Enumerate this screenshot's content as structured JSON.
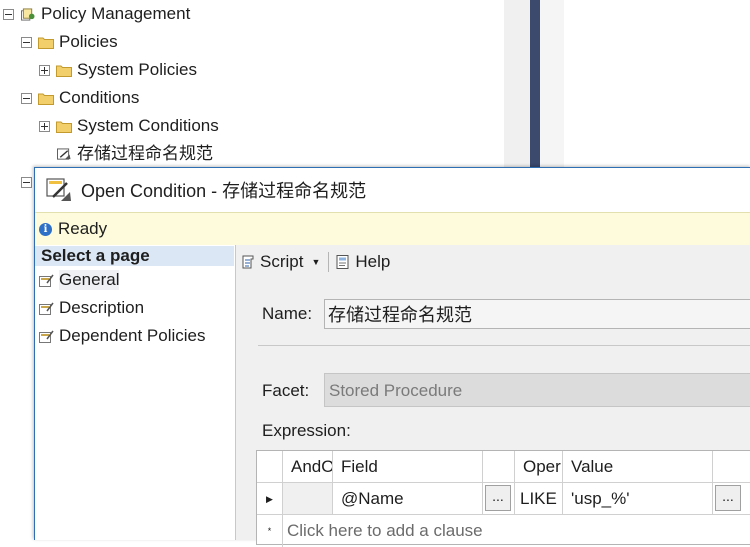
{
  "tree": {
    "items": [
      {
        "label": "Policy Management",
        "expander": "minus",
        "icon": "policy-management-icon"
      },
      {
        "label": "Policies",
        "expander": "minus",
        "icon": "folder-icon"
      },
      {
        "label": "System Policies",
        "expander": "plus",
        "icon": "folder-icon"
      },
      {
        "label": "Conditions",
        "expander": "minus",
        "icon": "folder-icon"
      },
      {
        "label": "System Conditions",
        "expander": "plus",
        "icon": "folder-icon"
      },
      {
        "label": "存储过程命名规范",
        "expander": "none",
        "icon": "condition-icon"
      }
    ]
  },
  "dialog": {
    "title": "Open Condition - 存储过程命名规范",
    "status": "Ready",
    "pages": {
      "header": "Select a page",
      "items": [
        {
          "label": "General",
          "selected": true
        },
        {
          "label": "Description",
          "selected": false
        },
        {
          "label": "Dependent Policies",
          "selected": false
        }
      ]
    },
    "toolbar": {
      "script_label": "Script",
      "help_label": "Help"
    },
    "form": {
      "name_label": "Name:",
      "name_value": "存储过程命名规范",
      "facet_label": "Facet:",
      "facet_value": "Stored Procedure",
      "expression_label": "Expression:"
    },
    "grid": {
      "columns": [
        "AndOr",
        "Field",
        "Oper",
        "Value"
      ],
      "rows": [
        {
          "andor": "",
          "field": "@Name",
          "operator": "LIKE",
          "value": "'usp_%'"
        }
      ],
      "ellipsis_label": "...",
      "add_clause_marker": "*",
      "add_clause": "Click here to add a clause"
    }
  },
  "colors": {
    "splitter": "#3c4a6e",
    "status_bar": "#fdfbdc",
    "page_header": "#dbe7f4",
    "dialog_border": "#2e6eb2"
  }
}
